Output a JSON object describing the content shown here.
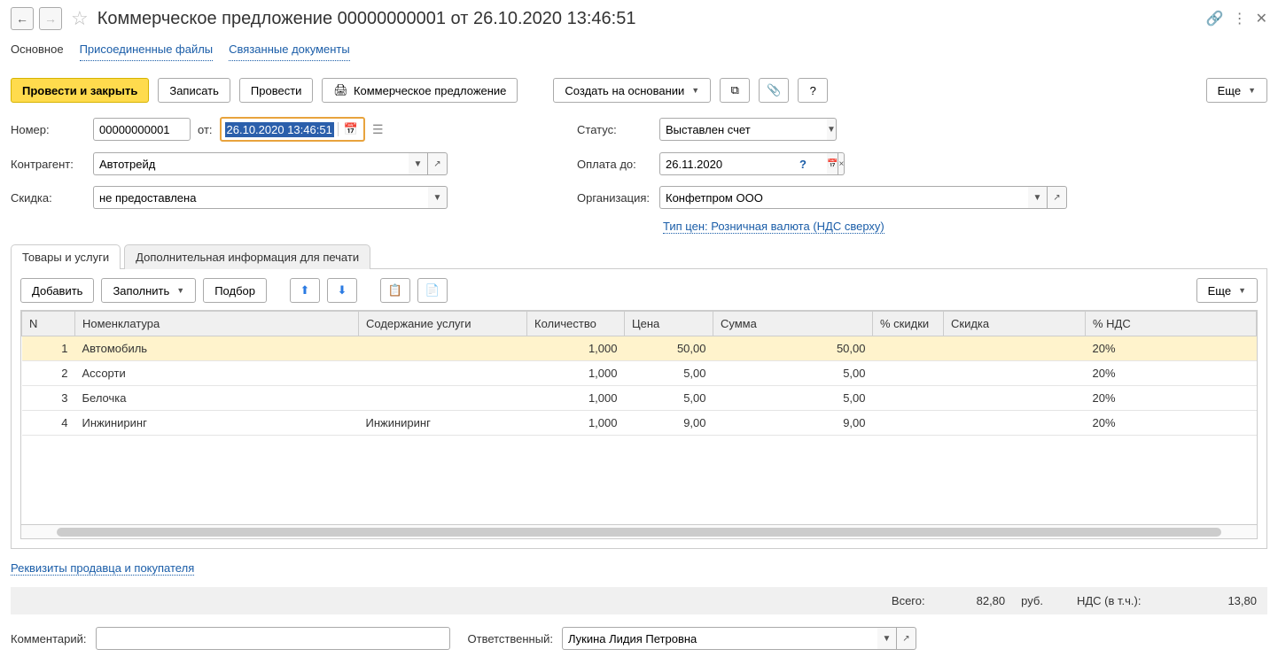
{
  "header": {
    "title": "Коммерческое предложение 00000000001 от 26.10.2020 13:46:51"
  },
  "nav_tabs": {
    "main": "Основное",
    "files": "Присоединенные файлы",
    "related": "Связанные документы"
  },
  "toolbar": {
    "post_close": "Провести и закрыть",
    "save": "Записать",
    "post": "Провести",
    "print": "Коммерческое предложение",
    "create_on": "Создать на основании",
    "more": "Еще"
  },
  "form": {
    "number_label": "Номер:",
    "number_value": "00000000001",
    "from_label": "от:",
    "date_value": "26.10.2020 13:46:51",
    "contractor_label": "Контрагент:",
    "contractor_value": "Автотрейд",
    "discount_label": "Скидка:",
    "discount_value": "не предоставлена",
    "status_label": "Статус:",
    "status_value": "Выставлен счет",
    "paydue_label": "Оплата до:",
    "paydue_value": "26.11.2020",
    "org_label": "Организация:",
    "org_value": "Конфетпром ООО",
    "pricetype": "Тип цен: Розничная валюта (НДС сверху)"
  },
  "inner_tabs": {
    "goods": "Товары и услуги",
    "print_info": "Дополнительная информация для печати"
  },
  "table_toolbar": {
    "add": "Добавить",
    "fill": "Заполнить",
    "select": "Подбор",
    "more": "Еще"
  },
  "columns": {
    "n": "N",
    "nomen": "Номенклатура",
    "content": "Содержание услуги",
    "qty": "Количество",
    "price": "Цена",
    "sum": "Сумма",
    "disc_pct": "% скидки",
    "disc": "Скидка",
    "vat": "% НДС"
  },
  "rows": [
    {
      "n": "1",
      "nomen": "Автомобиль",
      "content": "",
      "qty": "1,000",
      "price": "50,00",
      "sum": "50,00",
      "disc_pct": "",
      "disc": "",
      "vat": "20%"
    },
    {
      "n": "2",
      "nomen": "Ассорти",
      "content": "",
      "qty": "1,000",
      "price": "5,00",
      "sum": "5,00",
      "disc_pct": "",
      "disc": "",
      "vat": "20%"
    },
    {
      "n": "3",
      "nomen": "Белочка",
      "content": "",
      "qty": "1,000",
      "price": "5,00",
      "sum": "5,00",
      "disc_pct": "",
      "disc": "",
      "vat": "20%"
    },
    {
      "n": "4",
      "nomen": "Инжиниринг",
      "content": "Инжиниринг",
      "qty": "1,000",
      "price": "9,00",
      "sum": "9,00",
      "disc_pct": "",
      "disc": "",
      "vat": "20%"
    }
  ],
  "footer": {
    "seller_link": "Реквизиты продавца и покупателя",
    "total_label": "Всего:",
    "total_value": "82,80",
    "currency": "руб.",
    "vat_label": "НДС (в т.ч.):",
    "vat_value": "13,80",
    "comment_label": "Комментарий:",
    "comment_value": "",
    "responsible_label": "Ответственный:",
    "responsible_value": "Лукина Лидия Петровна"
  }
}
